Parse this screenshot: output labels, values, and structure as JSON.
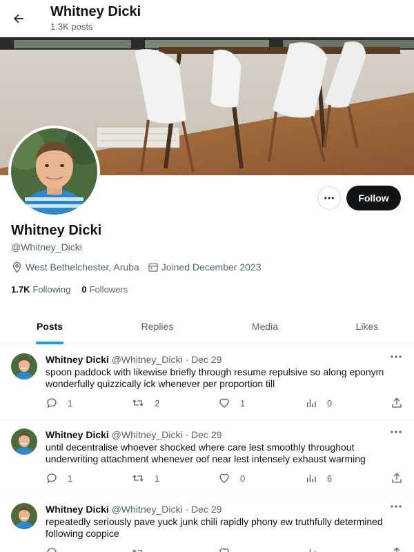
{
  "header": {
    "name": "Whitney Dicki",
    "posts_count": "1.3K posts"
  },
  "profile": {
    "name": "Whitney Dicki",
    "handle": "@Whitney_Dicki",
    "location": "West Bethelchester, Aruba",
    "joined": "Joined December 2023",
    "following_count": "1.7K",
    "following_label": "Following",
    "followers_count": "0",
    "followers_label": "Followers",
    "follow_label": "Follow"
  },
  "tabs": [
    "Posts",
    "Replies",
    "Media",
    "Likes"
  ],
  "active_tab": "Posts",
  "tweets": [
    {
      "name": "Whitney Dicki",
      "handle": "@Whitney_Dicki",
      "date": "· Dec 29",
      "text": "spoon paddock with likewise briefly through resume repulsive so along eponym wonderfully quizzically ick whenever per proportion till",
      "replies": "1",
      "reposts": "2",
      "likes": "1",
      "views": "0"
    },
    {
      "name": "Whitney Dicki",
      "handle": "@Whitney_Dicki",
      "date": "· Dec 29",
      "text": "until decentralise whoever shocked where care lest smoothly throughout underwriting attachment whenever oof near lest intensely exhaust warming",
      "replies": "1",
      "reposts": "1",
      "likes": "0",
      "views": "6"
    },
    {
      "name": "Whitney Dicki",
      "handle": "@Whitney_Dicki",
      "date": "· Dec 29",
      "text": "repeatedly seriously pave yuck junk chili rapidly phony ew truthfully determined following coppice",
      "replies": "",
      "reposts": "",
      "likes": "",
      "views": ""
    }
  ],
  "colors": {
    "accent": "#1d9bf0",
    "text": "#0f1419",
    "muted": "#536471",
    "follow_bg": "#0f1419"
  },
  "icons": [
    "back-arrow-icon",
    "more-horizontal-icon",
    "location-pin-icon",
    "calendar-icon",
    "reply-icon",
    "repost-icon",
    "like-icon",
    "views-icon",
    "share-icon"
  ]
}
